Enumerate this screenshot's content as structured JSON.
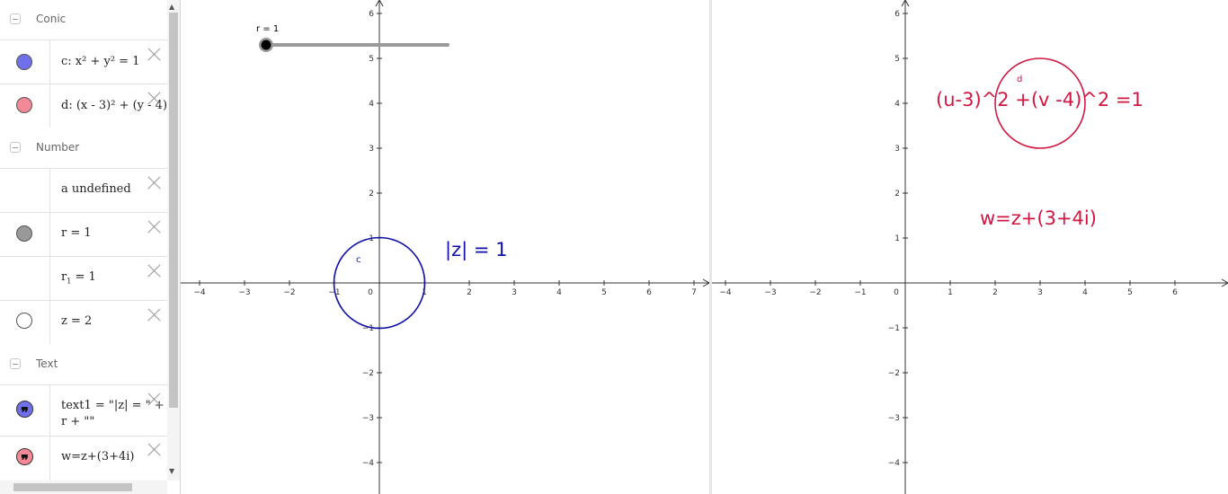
{
  "algebra": {
    "categories": [
      {
        "label": "Conic"
      },
      {
        "label": "Number"
      },
      {
        "label": "Text"
      }
    ],
    "items": [
      {
        "expr": "c: x² + y² = 1",
        "marble": "#7070ea"
      },
      {
        "expr": "d: (x - 3)² + (y - 4)",
        "marble": "#f38897"
      },
      {
        "expr": "a undefined"
      },
      {
        "expr": "r = 1",
        "marble": "#999999"
      },
      {
        "expr": "r",
        "sub": "1",
        "tail": " = 1"
      },
      {
        "expr": "z = 2",
        "marble": "#ffffff"
      },
      {
        "expr": "text1 = \"|z| = \" +",
        "expr2": "r + \"\"",
        "marble": "#7070ea"
      },
      {
        "expr": "w=z+(3+4i)",
        "marble": "#f38897"
      }
    ]
  },
  "slider": {
    "label": "r = 1"
  },
  "graphics1": {
    "circle_label": "c",
    "text": "|z| = 1",
    "color": "#1010a8"
  },
  "graphics2": {
    "circle_label": "d",
    "equation": "(u-3)^2 +(v -4)^2 =1",
    "mapping": "w=z+(3+4i)",
    "color": "#d21642"
  }
}
